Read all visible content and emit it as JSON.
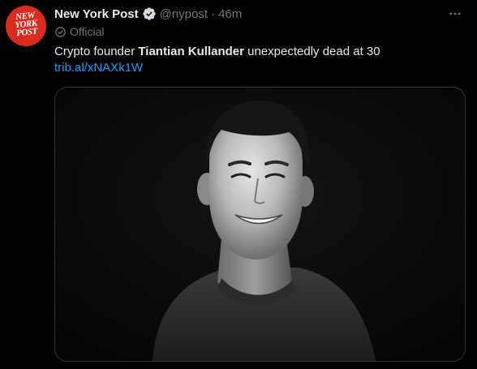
{
  "avatar": {
    "logo_lines": [
      "NEW",
      "YORK",
      "POST"
    ]
  },
  "author": {
    "name": "New York Post",
    "handle": "@nypost",
    "separator": "·",
    "time": "46m",
    "label": "Official"
  },
  "tweet": {
    "text_before": "Crypto founder ",
    "text_bold": "Tiantian Kullander",
    "text_after": " unexpectedly dead at 30",
    "link": "trib.al/xNAXk1W"
  },
  "more_icon": "more-horizontal-icon",
  "colors": {
    "background": "#000000",
    "text": "#e7e9ea",
    "muted": "#71767b",
    "link": "#1d9bf0",
    "brand_red": "#d92b1f"
  }
}
